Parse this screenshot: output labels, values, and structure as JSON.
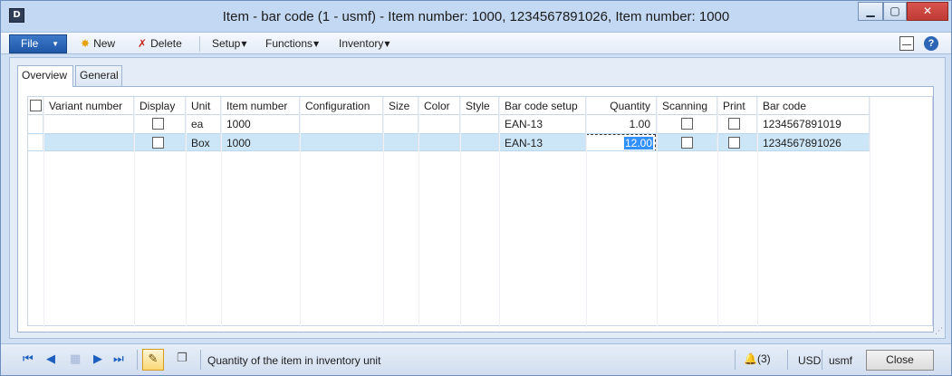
{
  "window": {
    "title": "Item - bar code (1 - usmf) - Item number: 1000, 1234567891026, Item number: 1000",
    "app_icon_label": "D"
  },
  "actionpane": {
    "file_label": "File",
    "new_label": "New",
    "delete_label": "Delete",
    "setup_label": "Setup",
    "functions_label": "Functions",
    "inventory_label": "Inventory"
  },
  "tabs": [
    {
      "label": "Overview",
      "active": true
    },
    {
      "label": "General",
      "active": false
    }
  ],
  "grid": {
    "columns": {
      "variant_number": "Variant number",
      "display": "Display",
      "unit": "Unit",
      "item_number": "Item number",
      "configuration": "Configuration",
      "size": "Size",
      "color": "Color",
      "style": "Style",
      "bar_code_setup": "Bar code setup",
      "quantity": "Quantity",
      "scanning": "Scanning",
      "print": "Print",
      "bar_code": "Bar code"
    },
    "rows": [
      {
        "variant_number": "",
        "display": false,
        "unit": "ea",
        "item_number": "1000",
        "configuration": "",
        "size": "",
        "color": "",
        "style": "",
        "bar_code_setup": "EAN-13",
        "quantity": "1.00",
        "scanning": false,
        "print": false,
        "bar_code": "1234567891019"
      },
      {
        "variant_number": "",
        "display": false,
        "unit": "Box",
        "item_number": "1000",
        "configuration": "",
        "size": "",
        "color": "",
        "style": "",
        "bar_code_setup": "EAN-13",
        "quantity": "12.00",
        "scanning": false,
        "print": false,
        "bar_code": "1234567891026",
        "selected": true
      }
    ]
  },
  "statusbar": {
    "help_text": "Quantity of the item in inventory unit",
    "notifications": "(3)",
    "currency": "USD",
    "company": "usmf",
    "close_label": "Close"
  },
  "colors": {
    "selection_row": "#cde6f7",
    "file_button": "#1f57a8",
    "accent_blue": "#1d5fbf"
  }
}
